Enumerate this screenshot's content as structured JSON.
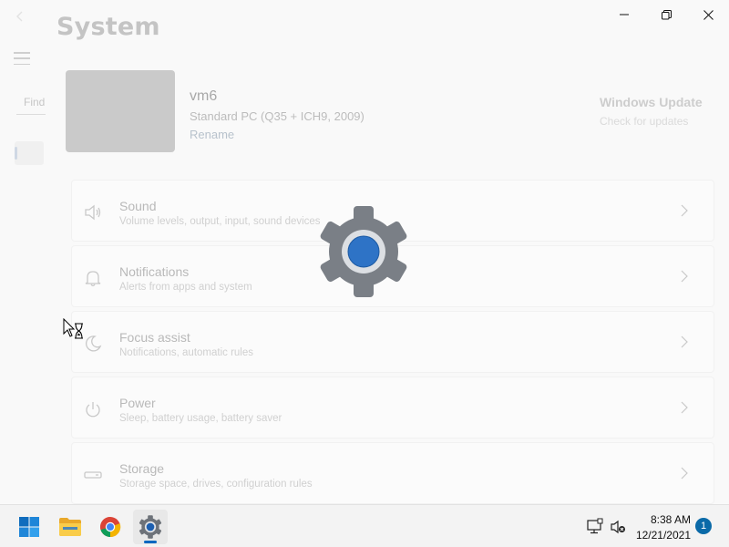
{
  "window": {
    "title": "System",
    "controls": {
      "minimize": "minimize",
      "maximize": "restore",
      "close": "close"
    }
  },
  "sidebar": {
    "search_placeholder": "Find a setting"
  },
  "device": {
    "name": "vm6",
    "model": "Standard PC (Q35 + ICH9, 2009)",
    "rename_label": "Rename"
  },
  "windows_update": {
    "title": "Windows Update",
    "subtitle": "Check for updates"
  },
  "settings": [
    {
      "title": "Sound",
      "description": "Volume levels, output, input, sound devices",
      "icon": "speaker-icon"
    },
    {
      "title": "Notifications",
      "description": "Alerts from apps and system",
      "icon": "bell-icon"
    },
    {
      "title": "Focus assist",
      "description": "Notifications, automatic rules",
      "icon": "moon-icon"
    },
    {
      "title": "Power",
      "description": "Sleep, battery usage, battery saver",
      "icon": "power-icon"
    },
    {
      "title": "Storage",
      "description": "Storage space, drives, configuration rules",
      "icon": "drive-icon"
    }
  ],
  "taskbar": {
    "apps": [
      {
        "name": "Start",
        "icon": "windows-logo-icon"
      },
      {
        "name": "File Explorer",
        "icon": "folder-icon"
      },
      {
        "name": "Google Chrome",
        "icon": "chrome-icon"
      },
      {
        "name": "Settings",
        "icon": "gear-icon",
        "active": true
      }
    ],
    "clock": {
      "time": "8:38 AM",
      "date": "12/21/2021"
    },
    "notification_count": "1"
  },
  "colors": {
    "accent": "#0067c0",
    "gear_outer": "#7a7f86",
    "gear_center": "#2e73c6",
    "badge": "#0b6aa8"
  }
}
